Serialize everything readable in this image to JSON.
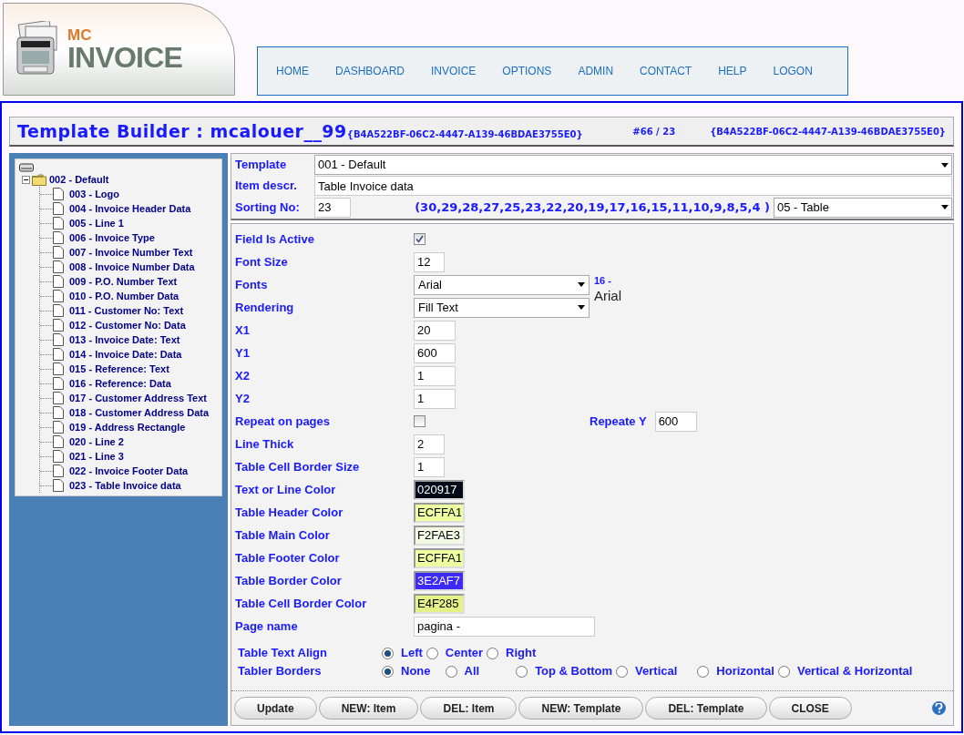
{
  "logo": {
    "top": "MC",
    "main": "INVOICE"
  },
  "nav": [
    "HOME",
    "DASHBOARD",
    "INVOICE",
    "OPTIONS",
    "ADMIN",
    "CONTACT",
    "HELP",
    "LOGON"
  ],
  "title_bar": {
    "title": "Template Builder : mcalouer__99",
    "guid": "{B4A522BF-06C2-4447-A139-46BDAE3755E0}",
    "counter": "#66 / 23",
    "guid_right": "{B4A522BF-06C2-4447-A139-46BDAE3755E0}"
  },
  "tree": [
    {
      "label": "002 - Default",
      "expanded": true,
      "children": [
        {
          "label": "003 - Logo"
        },
        {
          "label": "004 - Invoice Header Data"
        },
        {
          "label": "005 - Line 1"
        },
        {
          "label": "006 - Invoice Type"
        },
        {
          "label": "007 - Invoice Number Text"
        },
        {
          "label": "008 - Invoice Number Data"
        },
        {
          "label": "009 - P.O. Number Text"
        },
        {
          "label": "010 - P.O. Number Data"
        },
        {
          "label": "011 - Customer No: Text"
        },
        {
          "label": "012 - Customer No: Data"
        },
        {
          "label": "013 - Invoice Date: Text"
        },
        {
          "label": "014 - Invoice Date: Data"
        },
        {
          "label": "015 - Reference: Text"
        },
        {
          "label": "016 - Reference: Data"
        },
        {
          "label": "017 - Customer Address Text"
        },
        {
          "label": "018 - Customer Address Data"
        },
        {
          "label": "019 - Address Rectangle"
        },
        {
          "label": "020 - Line 2"
        },
        {
          "label": "021 - Line 3"
        },
        {
          "label": "022 - Invoice Footer Data"
        },
        {
          "label": "023 - Table Invoice data"
        }
      ]
    }
  ],
  "header_form": {
    "template_label": "Template",
    "template_value": "001 - Default",
    "descr_label": "Item descr.",
    "descr_value": "Table Invoice data",
    "sorting_label": "Sorting No:",
    "sorting_value": "23",
    "sorting_list": "(30,29,28,27,25,23,22,20,19,17,16,15,11,10,9,8,5,4 )",
    "type_value": "05 - Table"
  },
  "fields": [
    {
      "kind": "checkbox",
      "label": "Field Is Active",
      "checked": true
    },
    {
      "kind": "small-input",
      "label": "Font Size",
      "value": "12"
    },
    {
      "kind": "select",
      "label": "Fonts",
      "value": "Arial",
      "note": "16 -",
      "note_font": "Arial"
    },
    {
      "kind": "select",
      "label": "Rendering",
      "value": "Fill Text"
    },
    {
      "kind": "input",
      "label": "X1",
      "value": "20"
    },
    {
      "kind": "input",
      "label": "Y1",
      "value": "600"
    },
    {
      "kind": "input",
      "label": "X2",
      "value": "1"
    },
    {
      "kind": "input",
      "label": "Y2",
      "value": "1"
    },
    {
      "kind": "checkbox",
      "label": "Repeat on pages",
      "checked": false,
      "extra_label": "Repeate Y",
      "extra_value": "600"
    },
    {
      "kind": "small-input",
      "label": "Line Thick",
      "value": "2"
    },
    {
      "kind": "small-input",
      "label": "Table Cell Border Size",
      "value": "1"
    },
    {
      "kind": "color",
      "label": "Text or Line Color",
      "value": "020917",
      "color": "#020917"
    },
    {
      "kind": "color",
      "label": "Table Header Color",
      "value": "ECFFA1",
      "color": "#ecffa1"
    },
    {
      "kind": "color",
      "label": "Table Main Color",
      "value": "F2FAE3",
      "color": "#f2fae3"
    },
    {
      "kind": "color",
      "label": "Table Footer Color",
      "value": "ECFFA1",
      "color": "#ecffa1"
    },
    {
      "kind": "color",
      "label": "Table Border Color",
      "value": "3E2AF7",
      "color": "#3e2af7"
    },
    {
      "kind": "color",
      "label": "Table Cell Border Color",
      "value": "E4F285",
      "color": "#e4f285"
    },
    {
      "kind": "text",
      "label": "Page name",
      "value": "pagina -"
    }
  ],
  "radio_groups": [
    {
      "label": "Table Text Align",
      "options": [
        {
          "label": "Left",
          "selected": true
        },
        {
          "label": "Center",
          "selected": false
        },
        {
          "label": "Right",
          "selected": false
        }
      ]
    },
    {
      "label": "Tabler Borders",
      "options": [
        {
          "label": "None",
          "selected": true
        },
        {
          "label": "All",
          "selected": false
        },
        {
          "label": "Top & Bottom",
          "selected": false
        },
        {
          "label": "Vertical",
          "selected": false
        },
        {
          "label": "Horizontal",
          "selected": false
        },
        {
          "label": "Vertical & Horizontal",
          "selected": false
        }
      ]
    }
  ],
  "buttons": [
    "Update",
    "NEW: Item",
    "DEL: Item",
    "NEW: Template",
    "DEL: Template",
    "CLOSE"
  ]
}
